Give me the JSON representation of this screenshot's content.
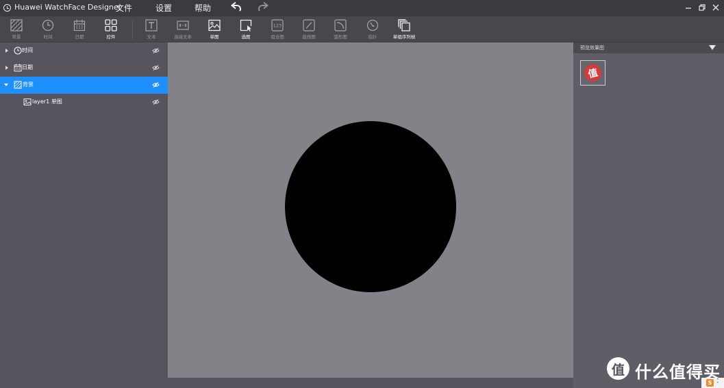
{
  "window": {
    "title": "Huawei WatchFace Designer",
    "menu": [
      "文件",
      "设置",
      "帮助"
    ]
  },
  "toolbar": {
    "tools": [
      {
        "label": "背景",
        "icon": "background-icon",
        "active": false
      },
      {
        "label": "时间",
        "icon": "clock-icon",
        "active": false
      },
      {
        "label": "日期",
        "icon": "calendar-icon",
        "active": false
      },
      {
        "label": "控件",
        "icon": "widgets-icon",
        "active": true
      },
      {
        "label": "文本",
        "icon": "text-icon",
        "active": false
      },
      {
        "label": "连接文本",
        "icon": "linked-text-icon",
        "active": false
      },
      {
        "label": "单图",
        "icon": "image-icon",
        "active": true
      },
      {
        "label": "选图",
        "icon": "select-image-icon",
        "active": true
      },
      {
        "label": "组合图",
        "icon": "combo-image-icon",
        "active": false
      },
      {
        "label": "直线图",
        "icon": "line-chart-icon",
        "active": false
      },
      {
        "label": "弧形图",
        "icon": "arc-chart-icon",
        "active": false
      },
      {
        "label": "指针",
        "icon": "pointer-icon",
        "active": false
      },
      {
        "label": "单组序列帧",
        "icon": "frame-sequence-icon",
        "active": true
      }
    ]
  },
  "layers": [
    {
      "label": "时间",
      "icon": "clock-icon",
      "expanded": false,
      "selected": false,
      "level": 0
    },
    {
      "label": "日期",
      "icon": "calendar-icon",
      "expanded": false,
      "selected": false,
      "level": 0
    },
    {
      "label": "背景",
      "icon": "background-icon",
      "expanded": true,
      "selected": true,
      "level": 0
    },
    {
      "label": "layer1 单图",
      "icon": "image-icon",
      "expanded": false,
      "selected": false,
      "level": 1
    }
  ],
  "preview": {
    "title": "预览效果图",
    "thumbnail_glyph": "值"
  },
  "watermark": {
    "glyph": "值",
    "text": "什么值得买"
  },
  "colors": {
    "selection": "#1e8fff",
    "canvas": "#838288",
    "watch_face": "#000000"
  }
}
